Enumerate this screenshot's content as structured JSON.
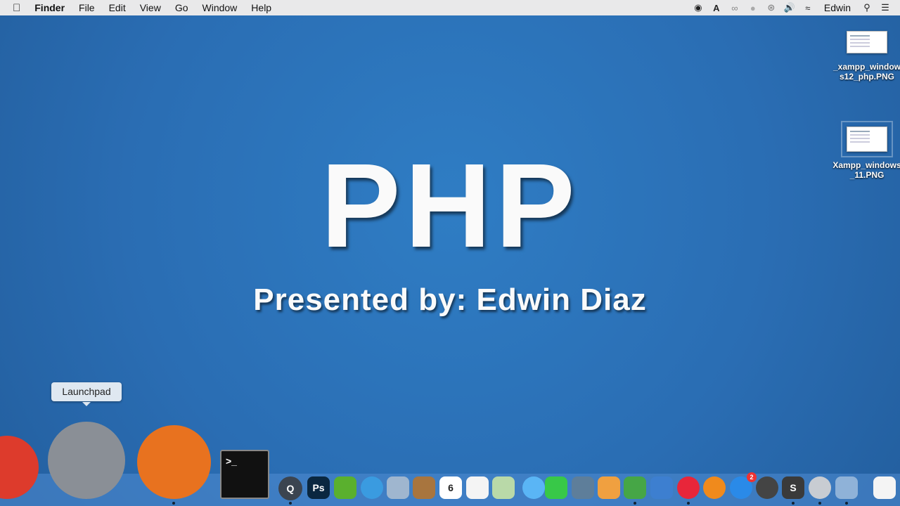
{
  "menubar": {
    "app": "Finder",
    "items": [
      "File",
      "Edit",
      "View",
      "Go",
      "Window",
      "Help"
    ],
    "user": "Edwin",
    "status_icons": [
      "record-icon",
      "adobe-icon",
      "creative-cloud-icon",
      "notification-icon",
      "bluetooth-icon",
      "volume-icon",
      "wifi-icon"
    ]
  },
  "desktop": {
    "title": "PHP",
    "subtitle": "Presented by: Edwin Diaz",
    "files": [
      {
        "name": "_xampp_windows12_php.PNG"
      },
      {
        "name": "Xampp_windows_11.PNG"
      }
    ]
  },
  "dock": {
    "tooltip": "Launchpad",
    "items": [
      {
        "name": "chrome",
        "color": "#dd3b2c",
        "running": false
      },
      {
        "name": "launchpad",
        "color": "#8a8f96",
        "running": false
      },
      {
        "name": "firefox",
        "color": "#e8721f",
        "running": true
      },
      {
        "name": "terminal",
        "color": "#111111",
        "label": ">_",
        "running": false
      },
      {
        "name": "quicktime",
        "color": "#3b4450",
        "label": "Q",
        "running": true
      },
      {
        "name": "photoshop",
        "color": "#0a2740",
        "label": "Ps",
        "running": false
      },
      {
        "name": "leaf",
        "color": "#5ab02e",
        "running": false
      },
      {
        "name": "safari",
        "color": "#3a9be0",
        "running": false
      },
      {
        "name": "mail",
        "color": "#9fb6cf",
        "running": false
      },
      {
        "name": "contacts",
        "color": "#a8753e",
        "running": false
      },
      {
        "name": "calendar",
        "color": "#ffffff",
        "label": "6",
        "running": false
      },
      {
        "name": "reminders",
        "color": "#f4f4f4",
        "running": false
      },
      {
        "name": "maps",
        "color": "#b9d9a8",
        "running": false
      },
      {
        "name": "messages",
        "color": "#5ab5f5",
        "running": false
      },
      {
        "name": "facetime",
        "color": "#38c848",
        "running": false
      },
      {
        "name": "iphoto",
        "color": "#5e7e9a",
        "running": false
      },
      {
        "name": "pages",
        "color": "#f0a040",
        "running": false
      },
      {
        "name": "numbers",
        "color": "#46a646",
        "running": true
      },
      {
        "name": "keynote",
        "color": "#3d7fd0",
        "running": false
      },
      {
        "name": "itunes",
        "color": "#e8263a",
        "running": true
      },
      {
        "name": "ibooks",
        "color": "#f08a1c",
        "running": false
      },
      {
        "name": "app-store",
        "color": "#2a8ae8",
        "badge": "2",
        "running": false
      },
      {
        "name": "activity-gear",
        "color": "#444444",
        "running": false
      },
      {
        "name": "sublime-text",
        "color": "#3a3a3a",
        "label": "S",
        "running": true
      },
      {
        "name": "system-preferences",
        "color": "#c8ccd2",
        "running": true
      },
      {
        "name": "preview",
        "color": "#8fb2d8",
        "running": true
      },
      {
        "name": "documents",
        "color": "#f4f4f4",
        "running": false
      }
    ]
  }
}
